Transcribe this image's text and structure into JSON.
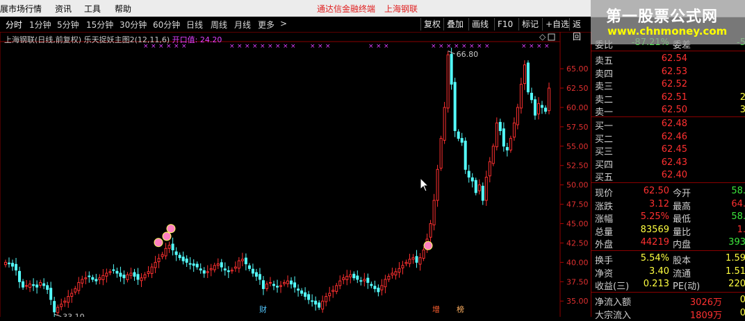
{
  "menubar": {
    "items": [
      "展市场行情",
      "资讯",
      "工具",
      "帮助"
    ],
    "center_left": "通达信金融终端",
    "center_right": "上海钢联"
  },
  "logo": {
    "title": "第一股票公式网",
    "url": "www.chnmoney.com"
  },
  "toolbar": {
    "periods": [
      "分时",
      "1分钟",
      "5分钟",
      "15分钟",
      "30分钟",
      "60分钟",
      "日线",
      "周线",
      "月线",
      "更多"
    ],
    "more_arrow": ">",
    "buttons": [
      "复权",
      "叠加",
      "画线",
      "F10",
      "标记",
      "+自选",
      "返回"
    ],
    "diamond": "◇"
  },
  "chart": {
    "stock_title": "上海钢联(日线,前复权) 乐天捉妖主图2(12,11,6)",
    "indicator_label": "开口值: 24.20",
    "high_label": "66.80",
    "low_label": "33.10",
    "markers": [
      "财",
      "增",
      "榜"
    ]
  },
  "chart_data": {
    "type": "candlestick",
    "y_ticks": [
      35.0,
      37.5,
      40.0,
      42.5,
      45.0,
      47.5,
      50.0,
      52.5,
      55.0,
      57.5,
      60.0,
      62.5,
      65.0
    ],
    "y_tick_labels": [
      "35.00",
      "37.50",
      "40.00",
      "42.50",
      "45.00",
      "47.50",
      "50.00",
      "52.50",
      "55.00",
      "57.50",
      "60.00",
      "62.50",
      "65.00"
    ],
    "ylim": [
      33.5,
      68.5
    ],
    "up_color": "#ff3030",
    "down_color": "#54ffff",
    "closes": [
      40.0,
      39.8,
      39.5,
      39.0,
      37.5,
      36.8,
      37.0,
      37.2,
      37.0,
      36.8,
      37.4,
      37.0,
      36.5,
      35.2,
      33.6,
      34.2,
      34.6,
      35.0,
      35.6,
      36.0,
      36.6,
      37.4,
      37.8,
      38.0,
      38.2,
      37.8,
      37.6,
      38.0,
      38.3,
      38.6,
      38.8,
      39.0,
      38.6,
      38.2,
      38.0,
      38.4,
      38.6,
      38.2,
      37.8,
      38.0,
      38.4,
      38.8,
      39.4,
      40.0,
      40.5,
      41.0,
      41.8,
      42.2,
      41.6,
      41.0,
      40.6,
      40.2,
      40.0,
      39.8,
      39.6,
      39.4,
      39.0,
      38.6,
      38.8,
      39.2,
      39.6,
      39.8,
      39.4,
      39.0,
      38.8,
      39.0,
      39.4,
      40.2,
      40.4,
      39.8,
      39.2,
      38.6,
      38.2,
      37.8,
      36.6,
      37.2,
      37.4,
      37.0,
      36.8,
      37.0,
      37.4,
      37.6,
      37.2,
      36.8,
      36.4,
      36.0,
      35.6,
      35.2,
      35.0,
      34.6,
      34.2,
      35.0,
      35.6,
      36.0,
      36.4,
      37.0,
      37.6,
      38.0,
      38.2,
      38.4,
      38.0,
      37.8,
      37.6,
      37.8,
      37.4,
      37.0,
      36.6,
      36.2,
      37.0,
      37.8,
      38.2,
      38.6,
      38.8,
      39.2,
      39.6,
      40.0,
      40.4,
      40.6,
      40.0,
      40.6,
      41.6,
      43.0,
      45.0,
      48.0,
      52.0,
      56.0,
      60.0,
      66.8,
      63.0,
      57.0,
      56.0,
      55.5,
      52.0,
      51.0,
      50.5,
      49.0,
      50.0,
      48.0,
      51.0,
      53.0,
      55.0,
      58.0,
      57.0,
      55.0,
      54.5,
      56.0,
      58.0,
      60.0,
      63.0,
      65.5,
      62.0,
      61.0,
      59.0,
      60.5,
      60.0,
      59.5,
      62.5
    ]
  },
  "quote": {
    "weibi": {
      "label": "委比",
      "value": "-87.21%",
      "label2": "委差",
      "value2": "-5"
    },
    "sells": [
      {
        "label": "卖五",
        "price": "62.54",
        "vol": ""
      },
      {
        "label": "卖四",
        "price": "62.53",
        "vol": ""
      },
      {
        "label": "卖三",
        "price": "62.52",
        "vol": ""
      },
      {
        "label": "卖二",
        "price": "62.51",
        "vol": "2"
      },
      {
        "label": "卖一",
        "price": "62.50",
        "vol": "3"
      }
    ],
    "buys": [
      {
        "label": "买一",
        "price": "62.48",
        "vol": ""
      },
      {
        "label": "买二",
        "price": "62.46",
        "vol": ""
      },
      {
        "label": "买三",
        "price": "62.45",
        "vol": ""
      },
      {
        "label": "买四",
        "price": "62.43",
        "vol": ""
      },
      {
        "label": "买五",
        "price": "62.40",
        "vol": ""
      }
    ],
    "stats1": [
      {
        "l": "现价",
        "v": "62.50",
        "vc": "#ff3030",
        "l2": "今开",
        "v2": "58.",
        "v2c": "#3ce63c"
      },
      {
        "l": "涨跌",
        "v": "3.12",
        "vc": "#ff3030",
        "l2": "最高",
        "v2": "64.",
        "v2c": "#ff3030"
      },
      {
        "l": "涨幅",
        "v": "5.25%",
        "vc": "#ff3030",
        "l2": "最低",
        "v2": "58.",
        "v2c": "#3ce63c"
      },
      {
        "l": "总量",
        "v": "83569",
        "vc": "#ffff40",
        "l2": "量比",
        "v2": "1.",
        "v2c": "#ff3030"
      },
      {
        "l": "外盘",
        "v": "44219",
        "vc": "#ff3030",
        "l2": "内盘",
        "v2": "393",
        "v2c": "#3ce63c"
      }
    ],
    "stats2": [
      {
        "l": "换手",
        "v": "5.54%",
        "vc": "#ffff40",
        "l2": "股本",
        "v2": "1.59",
        "v2c": "#ffff40"
      },
      {
        "l": "净资",
        "v": "3.40",
        "vc": "#ffff40",
        "l2": "流通",
        "v2": "1.51",
        "v2c": "#ffff40"
      },
      {
        "l": "收益(三)",
        "v": "0.213",
        "vc": "#ffff40",
        "l2": "PE(动)",
        "v2": "220",
        "v2c": "#ffff40"
      }
    ],
    "flow": [
      {
        "l": "净流入额",
        "v": "3026万",
        "vc": "#ff3030",
        "v2": "0"
      },
      {
        "l": "大宗流入",
        "v": "1809万",
        "vc": "#ff3030",
        "v2": "0"
      }
    ]
  }
}
